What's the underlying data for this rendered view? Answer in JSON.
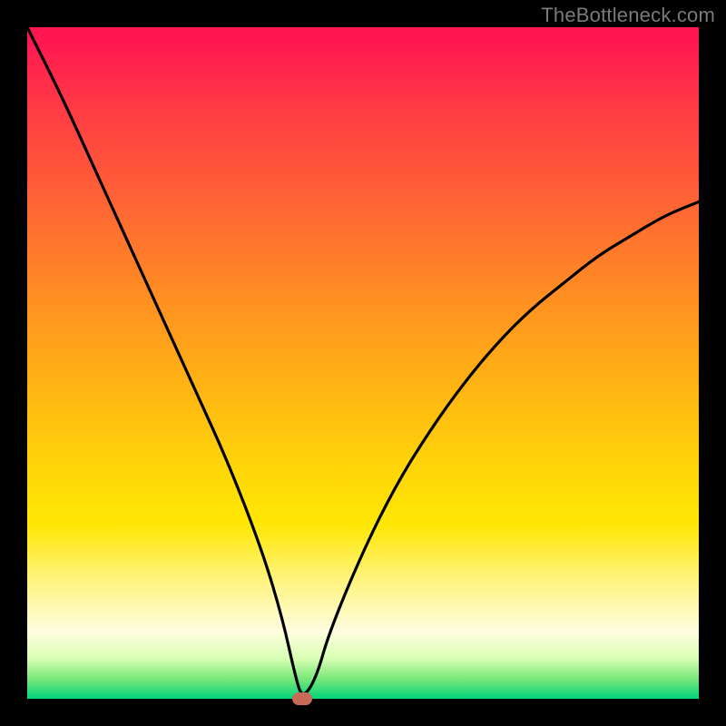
{
  "watermark": "TheBottleneck.com",
  "colors": {
    "frame_bg": "#000000",
    "curve_stroke": "#000000",
    "marker_fill": "#c76a5a",
    "gradient_top": "#ff1750",
    "gradient_bottom": "#00d47a"
  },
  "chart_data": {
    "type": "line",
    "title": "",
    "xlabel": "",
    "ylabel": "",
    "xlim": [
      0,
      100
    ],
    "ylim": [
      0,
      100
    ],
    "grid": false,
    "legend": null,
    "notes": "Background vertical gradient from red (high mismatch) through orange/yellow to green (optimal). Black curve shows bottleneck severity vs. an implicit x-axis balance parameter; minimum near x≈41 at y≈0.",
    "series": [
      {
        "name": "bottleneck-curve",
        "x": [
          0,
          5,
          10,
          15,
          20,
          25,
          30,
          35,
          38,
          40,
          41,
          43,
          45,
          50,
          55,
          60,
          65,
          70,
          75,
          80,
          85,
          90,
          95,
          100
        ],
        "y": [
          100,
          90,
          79,
          68,
          57,
          46,
          35,
          22,
          12,
          3,
          0,
          3,
          10,
          22,
          32,
          40,
          47,
          53,
          58,
          62,
          66,
          69,
          72,
          74
        ]
      }
    ],
    "marker": {
      "x": 41,
      "y": 0
    }
  }
}
